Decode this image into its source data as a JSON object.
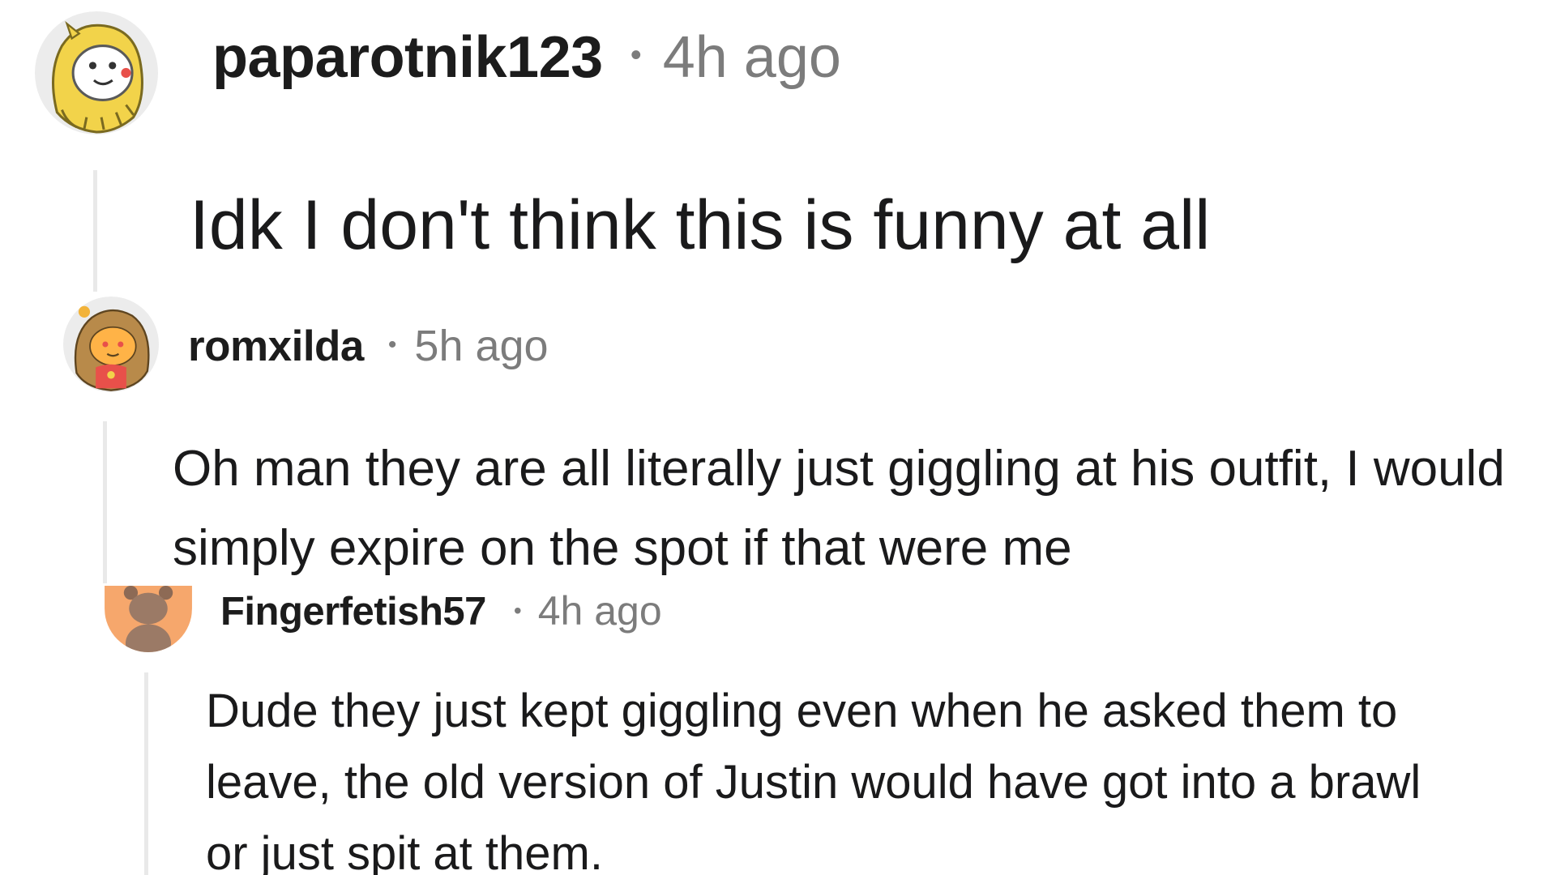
{
  "comments": [
    {
      "username": "paparotnik123",
      "separator": "•",
      "time": "4h ago",
      "body": "Idk I don't think this is funny at all",
      "avatar_icon": "yellow-lion-hood-avatar-icon"
    },
    {
      "username": "romxilda",
      "separator": "•",
      "time": "5h ago",
      "body": "Oh man they are all literally just giggling at his outfit, I would simply expire on the spot if that were me",
      "avatar_icon": "orange-haired-snoo-avatar-icon"
    },
    {
      "username": "Fingerfetish57",
      "separator": "•",
      "time": "4h ago",
      "body": "Dude they just kept giggling even when he asked them to leave, the old version of Justin would have got into a brawl or just spit at them.",
      "avatar_icon": "peach-default-snoo-avatar-icon"
    }
  ],
  "colors": {
    "background": "#ffffff",
    "username": "#1c1c1c",
    "meta_text": "#7c7c7c",
    "body_text": "#1a1a1b",
    "thread_line": "#e9e9e9",
    "avatar3_bg": "#f6a76c"
  }
}
